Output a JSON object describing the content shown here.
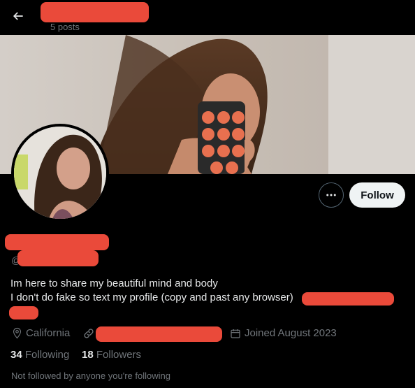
{
  "header": {
    "back_icon": "arrow-left-icon",
    "posts_count": "5 posts"
  },
  "actions": {
    "more_icon": "ellipsis-icon",
    "follow_label": "Follow"
  },
  "profile": {
    "handle_prefix": "@",
    "bio_line1": "Im here to share my beautiful mind and body",
    "bio_line2": "I don't do fake so text my profile (copy and past any browser)"
  },
  "meta": {
    "location_icon": "location-pin-icon",
    "location": "California",
    "link_icon": "link-icon",
    "calendar_icon": "calendar-icon",
    "joined": "Joined August 2023"
  },
  "stats": {
    "following_count": "34",
    "following_label": "Following",
    "followers_count": "18",
    "followers_label": "Followers"
  },
  "mutuals": {
    "text": "Not followed by anyone you're following"
  },
  "colors": {
    "background": "#000000",
    "redaction": "#ea4a3a",
    "secondary_text": "#71767b",
    "follow_button_bg": "#eff3f4"
  }
}
